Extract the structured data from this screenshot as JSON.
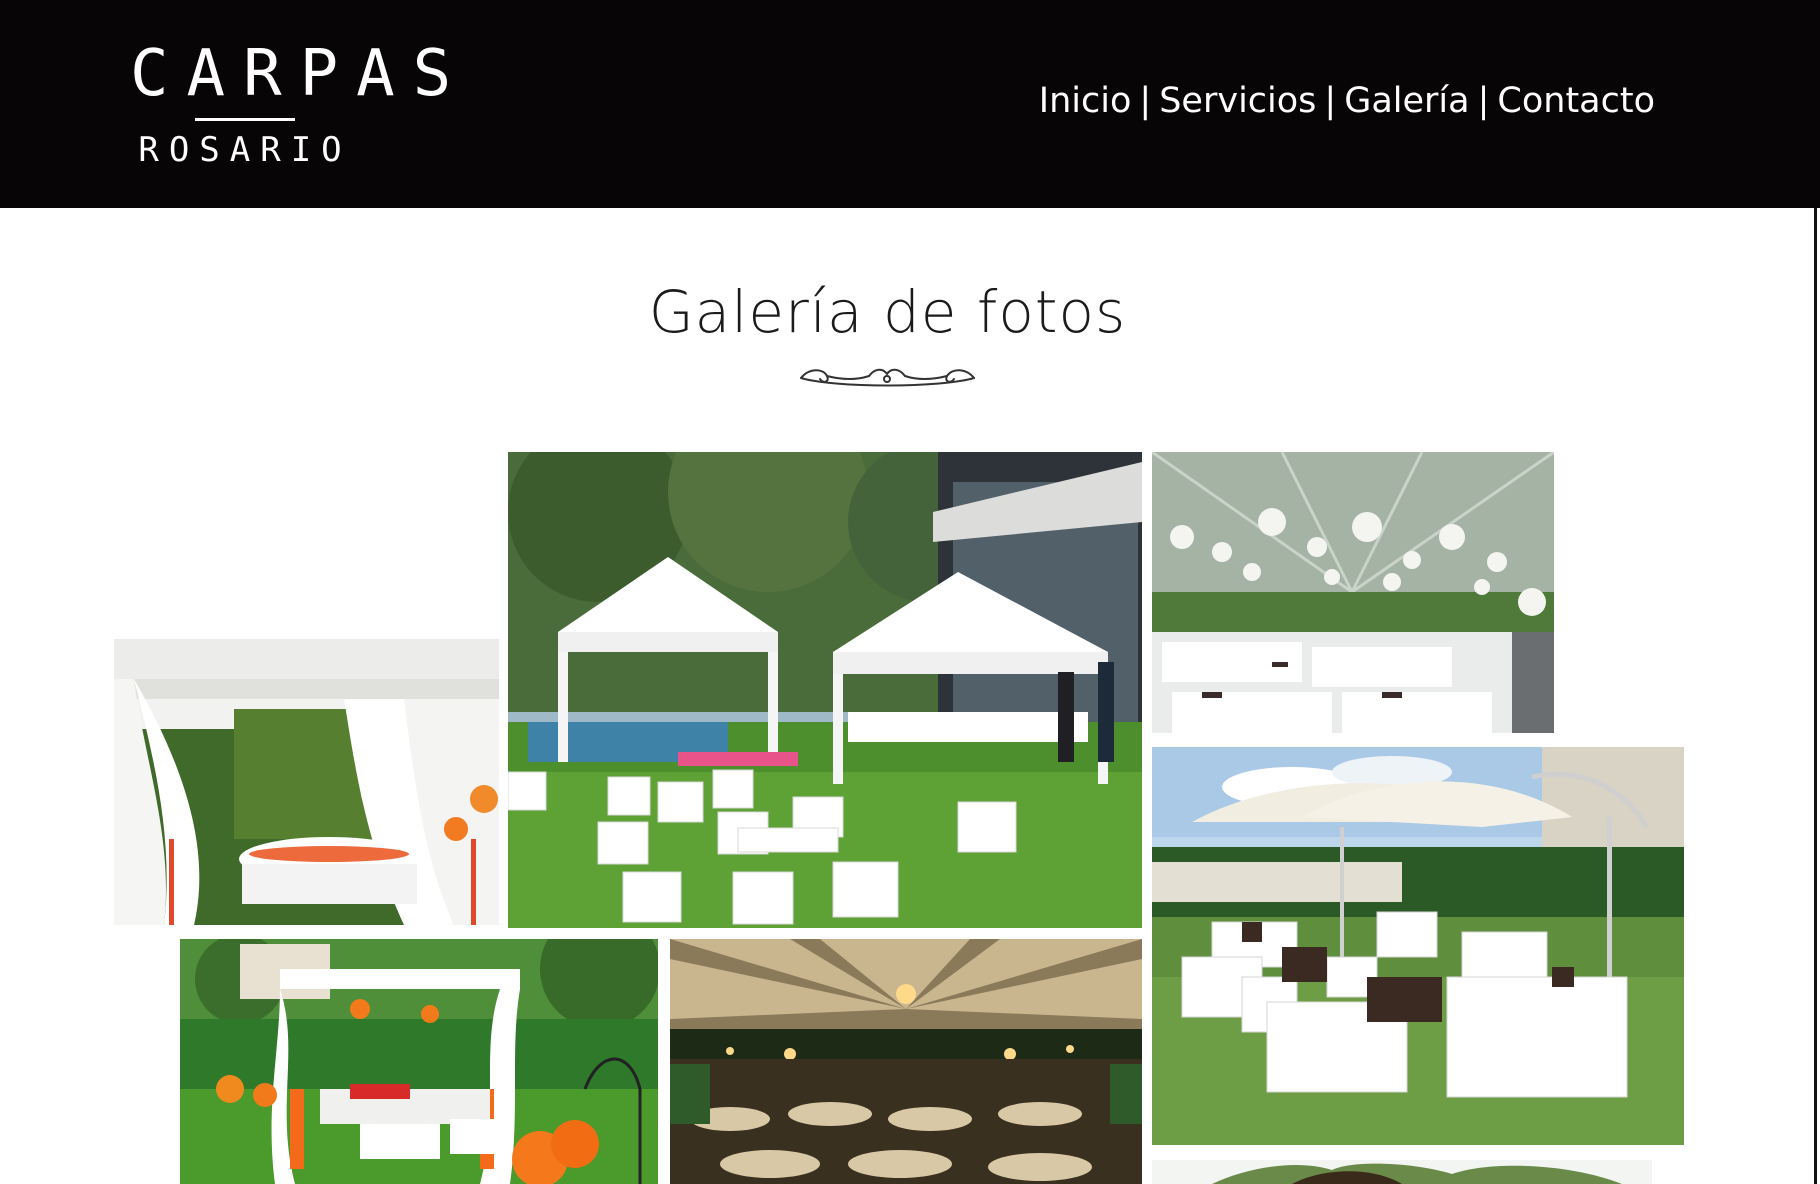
{
  "logo": {
    "main": "CARPAS",
    "sub": "ROSARIO"
  },
  "nav": {
    "items": [
      "Inicio",
      "Servicios",
      "Galería",
      "Contacto"
    ],
    "separator": "|"
  },
  "gallery": {
    "title": "Galería de fotos",
    "photos": [
      "white-draped-tent-round-table-orange-lanterns",
      "two-white-pagoda-tents-with-poufs-by-pool",
      "large-tent-with-paper-lanterns-and-banquet-tables",
      "cantilever-umbrellas-over-white-lounge-set",
      "pergola-with-orange-drapes-and-lanterns",
      "draped-tent-ceiling-with-chandeliers-evening",
      "tree-canopy-partial"
    ]
  },
  "colors": {
    "header_bg": "#070506",
    "header_text": "#ffffff",
    "title_text": "#1b1b1b",
    "page_bg": "#ffffff"
  }
}
